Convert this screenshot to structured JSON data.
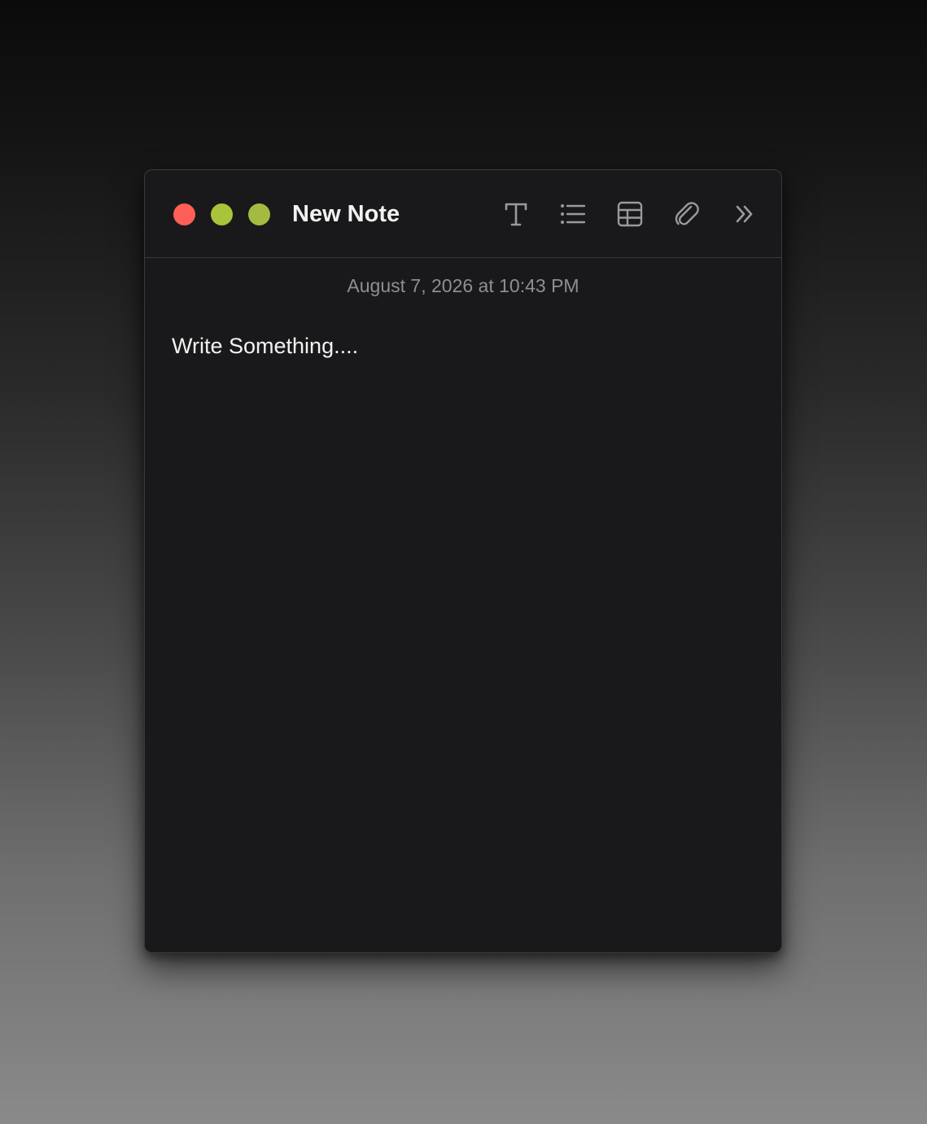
{
  "window": {
    "title": "New Note",
    "date": "August 7, 2026 at 10:43 PM",
    "body_text": "Write Something...."
  },
  "toolbar": {
    "icons": [
      "text-format-icon",
      "checklist-icon",
      "table-icon",
      "paperclip-icon",
      "chevron-double-right-icon"
    ]
  },
  "colors": {
    "close": "#ff5f57",
    "minimize": "#a9c43a",
    "zoom": "#a4bb42",
    "window_bg": "#19191b"
  }
}
